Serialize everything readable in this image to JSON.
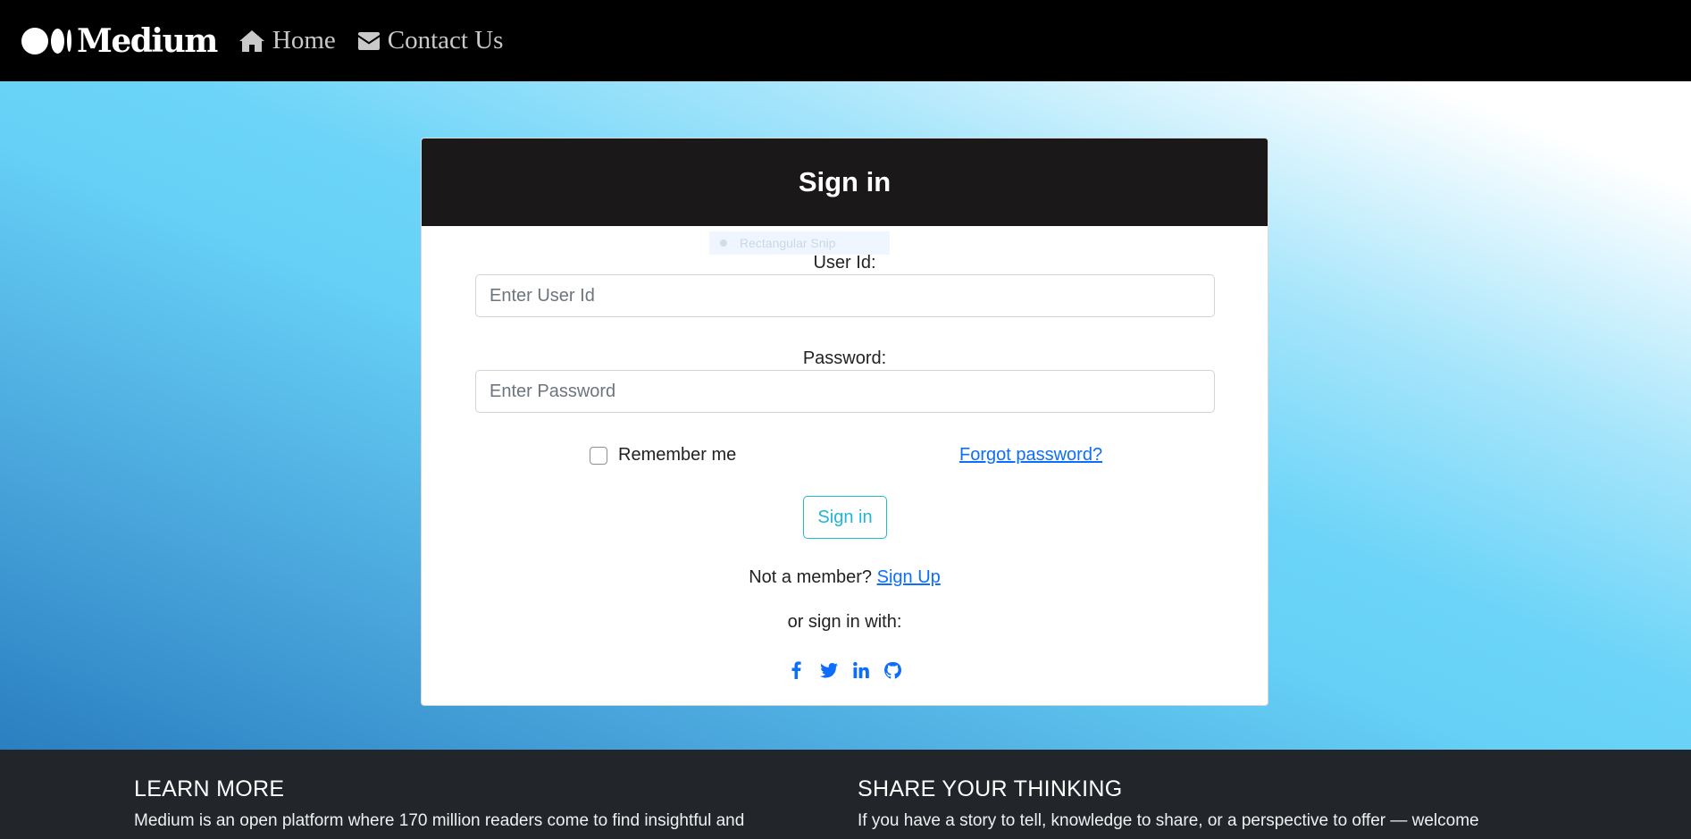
{
  "navbar": {
    "brand": "Medium",
    "links": [
      {
        "label": "Home",
        "icon": "home-icon"
      },
      {
        "label": "Contact Us",
        "icon": "envelope-icon"
      }
    ]
  },
  "signin_card": {
    "title": "Sign in",
    "snip_overlay": "Rectangular Snip",
    "user_id": {
      "label": "User Id:",
      "placeholder": "Enter User Id",
      "value": ""
    },
    "password": {
      "label": "Password:",
      "placeholder": "Enter Password",
      "value": ""
    },
    "remember_me": {
      "label": "Remember me",
      "checked": false
    },
    "forgot_password": "Forgot password?",
    "submit_label": "Sign in",
    "member_prompt": "Not a member?",
    "signup_link": "Sign Up",
    "alt_signin": "or sign in with:",
    "social_icons": [
      "facebook-icon",
      "twitter-icon",
      "linkedin-icon",
      "github-icon"
    ]
  },
  "footer": {
    "learn_more": {
      "heading": "LEARN MORE",
      "text": "Medium is an open platform where 170 million readers come to find insightful and"
    },
    "share": {
      "heading": "SHARE YOUR THINKING",
      "text": "If you have a story to tell, knowledge to share, or a perspective to offer — welcome"
    }
  },
  "colors": {
    "navbar_bg": "#000000",
    "card_header_bg": "#1a1819",
    "link": "#0d6efd",
    "signin_btn": "#1fb5d6",
    "footer_bg": "#22252a"
  }
}
